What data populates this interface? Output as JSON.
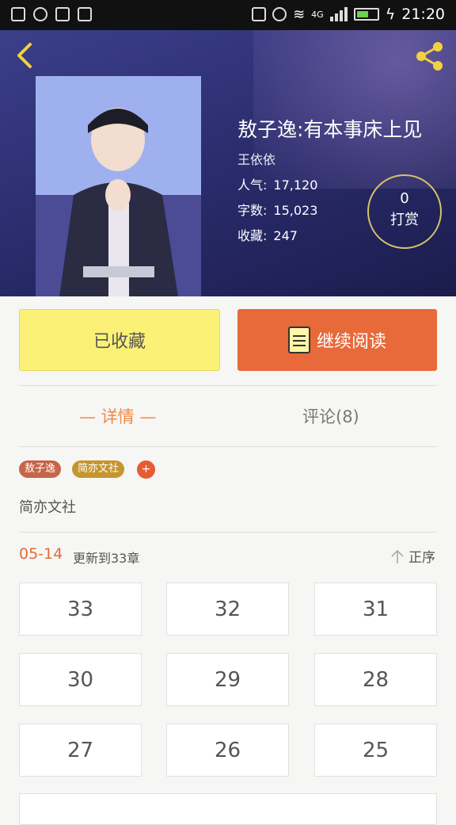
{
  "statusbar": {
    "time": "21:20",
    "network": "4G"
  },
  "book": {
    "title": "敖子逸:有本事床上见",
    "author": "王依依",
    "popularity_label": "人气:",
    "popularity": "17,120",
    "words_label": "字数:",
    "words": "15,023",
    "favorites_label": "收藏:",
    "favorites": "247"
  },
  "tip": {
    "count": "0",
    "label": "打赏"
  },
  "actions": {
    "collect": "已收藏",
    "read": "继续阅读"
  },
  "tabs": {
    "detail": "— 详情 —",
    "comment": "评论(8)"
  },
  "tags": [
    "敖子逸",
    "简亦文社"
  ],
  "tag_add": "+",
  "publisher": "简亦文社",
  "update": {
    "date": "05-14",
    "text": "更新到33章",
    "order": "正序"
  },
  "chapters": [
    "33",
    "32",
    "31",
    "30",
    "29",
    "28",
    "27",
    "26",
    "25"
  ],
  "colors": {
    "accent": "#e8693a",
    "collect": "#fbf177"
  }
}
